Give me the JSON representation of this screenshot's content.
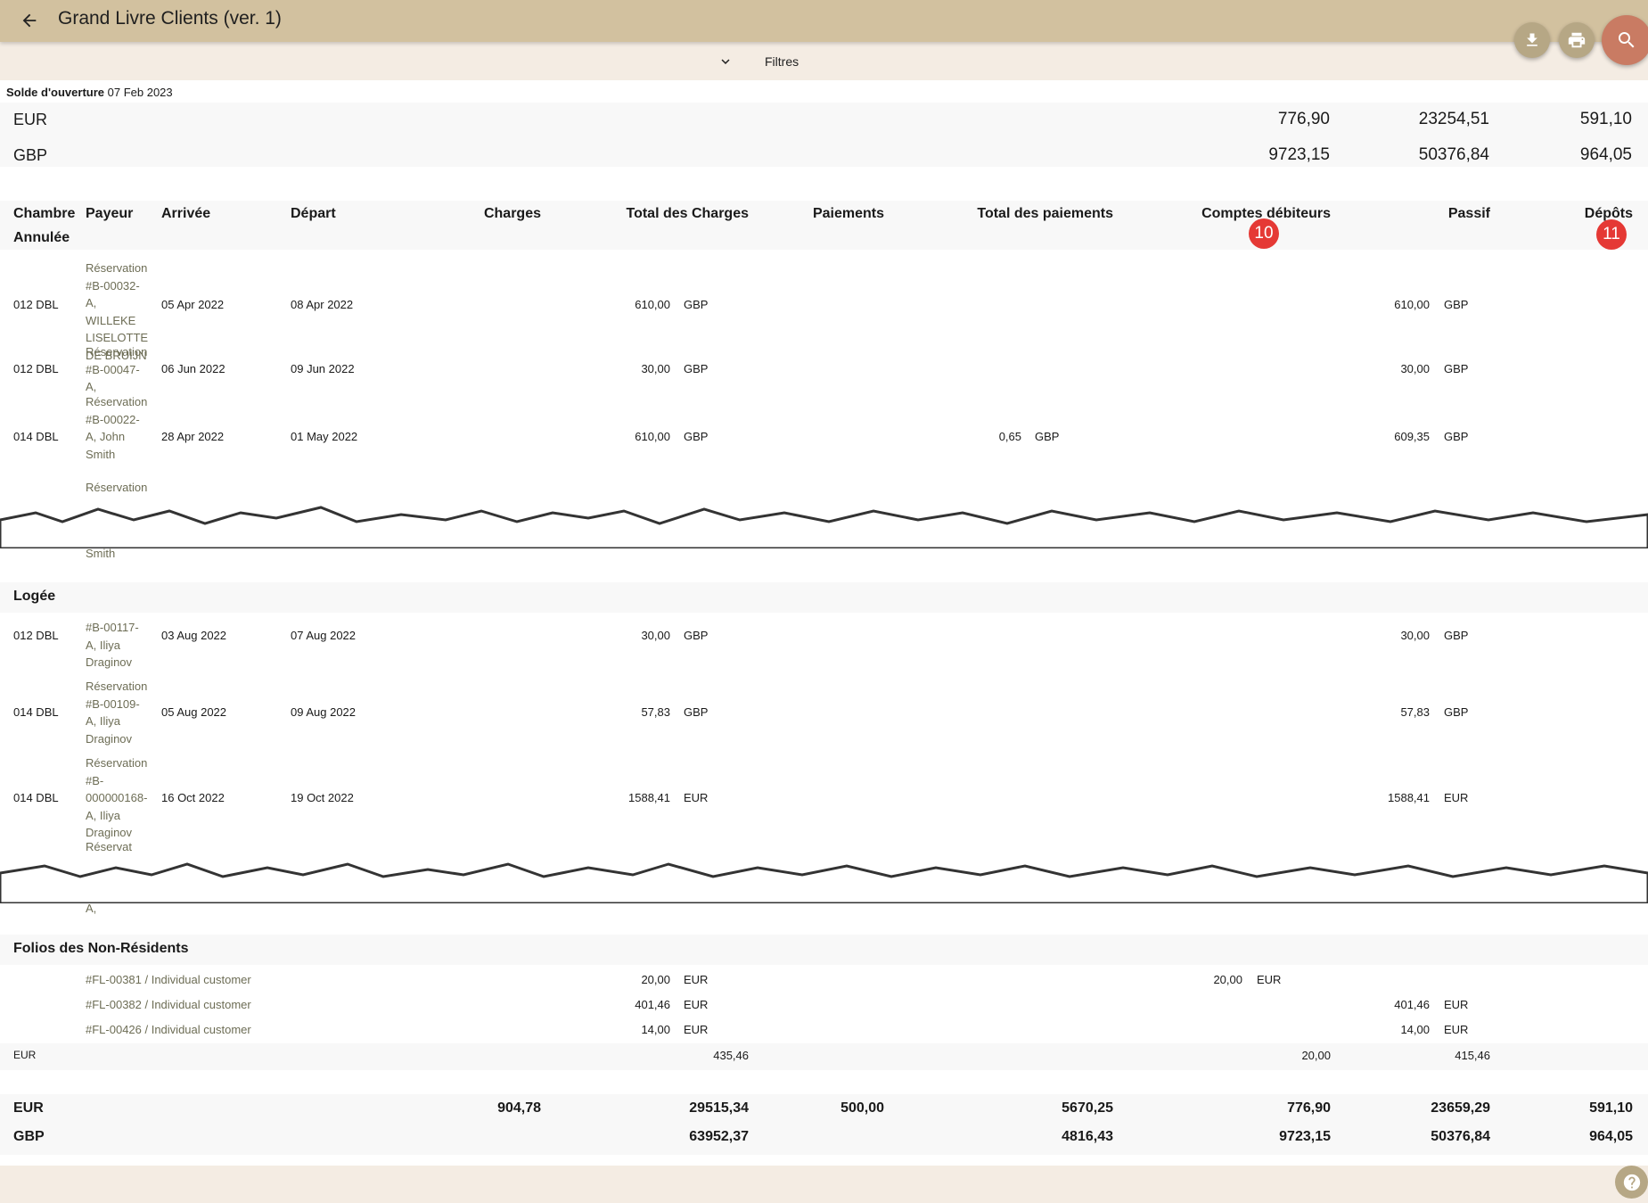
{
  "header": {
    "title": "Grand Livre Clients (ver. 1)"
  },
  "filters": {
    "label": "Filtres"
  },
  "opening": {
    "label": "Solde d'ouverture",
    "date": "07 Feb 2023",
    "rows": [
      {
        "currency": "EUR",
        "v1": "776,90",
        "v2": "23254,51",
        "v3": "591,10"
      },
      {
        "currency": "GBP",
        "v1": "9723,15",
        "v2": "50376,84",
        "v3": "964,05"
      }
    ]
  },
  "columns": {
    "room": "Chambre",
    "payer": "Payeur",
    "arrival": "Arrivée",
    "departure": "Départ",
    "charges": "Charges",
    "total_charges": "Total des Charges",
    "payments": "Paiements",
    "total_payments": "Total des paiements",
    "receivables": "Comptes débiteurs",
    "liabilities": "Passif",
    "deposits": "Dépôts"
  },
  "badges": {
    "receivables": "10",
    "deposits": "11"
  },
  "sections": {
    "cancelled": {
      "title": "Annulée",
      "rows": [
        {
          "room": "012 DBL",
          "payer": "Réservation #B-00032-A, WILLEKE LISELOTTE DE BRUIJN",
          "arrival": "05 Apr 2022",
          "departure": "08 Apr 2022",
          "total_charges": "610,00",
          "tc_cur": "GBP",
          "liab": "610,00",
          "liab_cur": "GBP"
        },
        {
          "room": "012 DBL",
          "payer": "Réservation #B-00047-A,",
          "arrival": "06 Jun 2022",
          "departure": "09 Jun 2022",
          "total_charges": "30,00",
          "tc_cur": "GBP",
          "liab": "30,00",
          "liab_cur": "GBP"
        },
        {
          "room": "014 DBL",
          "payer": "Réservation #B-00022-A, John Smith",
          "arrival": "28 Apr 2022",
          "departure": "01 May 2022",
          "total_charges": "610,00",
          "tc_cur": "GBP",
          "tp": "0,65",
          "tp_cur": "GBP",
          "liab": "609,35",
          "liab_cur": "GBP"
        }
      ],
      "torn_top": "Réservation",
      "torn_bottom": "Smith"
    },
    "lodged": {
      "title": "Logée",
      "rows": [
        {
          "room": "012 DBL",
          "payer": "#B-00117-A, Iliya Draginov",
          "arrival": "03 Aug 2022",
          "departure": "07 Aug 2022",
          "total_charges": "30,00",
          "tc_cur": "GBP",
          "liab": "30,00",
          "liab_cur": "GBP"
        },
        {
          "room": "014 DBL",
          "payer": "Réservation #B-00109-A, Iliya Draginov",
          "arrival": "05 Aug 2022",
          "departure": "09 Aug 2022",
          "total_charges": "57,83",
          "tc_cur": "GBP",
          "liab": "57,83",
          "liab_cur": "GBP"
        },
        {
          "room": "014 DBL",
          "payer": "Réservation #B-000000168-A, Iliya Draginov",
          "arrival": "16 Oct 2022",
          "departure": "19 Oct 2022",
          "total_charges": "1588,41",
          "tc_cur": "EUR",
          "liab": "1588,41",
          "liab_cur": "EUR"
        }
      ],
      "torn_top": "Réservat",
      "torn_bottom": "A,"
    },
    "nonres": {
      "title": "Folios des Non-Résidents",
      "rows": [
        {
          "payer": "#FL-00381 / Individual customer",
          "total_charges": "20,00",
          "tc_cur": "EUR",
          "recv": "20,00",
          "recv_cur": "EUR"
        },
        {
          "payer": "#FL-00382 / Individual customer",
          "total_charges": "401,46",
          "tc_cur": "EUR",
          "liab": "401,46",
          "liab_cur": "EUR"
        },
        {
          "payer": "#FL-00426 / Individual customer",
          "total_charges": "14,00",
          "tc_cur": "EUR",
          "liab": "14,00",
          "liab_cur": "EUR"
        }
      ],
      "subtotal": {
        "currency": "EUR",
        "total_charges": "435,46",
        "recv": "20,00",
        "liab": "415,46"
      }
    }
  },
  "grand_totals": [
    {
      "currency": "EUR",
      "charges": "904,78",
      "total_charges": "29515,34",
      "payments": "500,00",
      "total_payments": "5670,25",
      "recv": "776,90",
      "liab": "23659,29",
      "dep": "591,10"
    },
    {
      "currency": "GBP",
      "total_charges": "63952,37",
      "total_payments": "4816,43",
      "recv": "9723,15",
      "liab": "50376,84",
      "dep": "964,05"
    }
  ],
  "icons": {
    "back": "arrow-left-icon",
    "download": "download-icon",
    "print": "printer-icon",
    "search": "search-icon",
    "filter": "chevron-down-icon",
    "help": "help-icon"
  },
  "colors": {
    "appbar": "#d2c19f",
    "page": "#f4ece3",
    "fab": "#b6a785",
    "search_fab": "#c97b63",
    "badge": "#e53935",
    "payer_text": "#6d6d55"
  }
}
